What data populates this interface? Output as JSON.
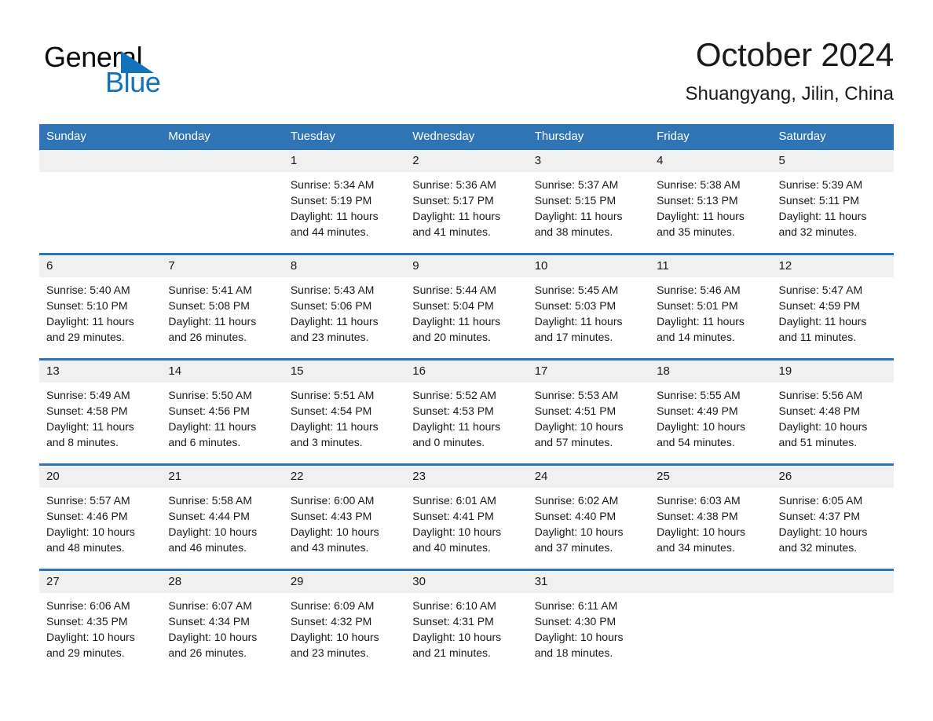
{
  "brand": {
    "logo_top": "General",
    "logo_bottom": "Blue",
    "accent_color": "#1272ba"
  },
  "header": {
    "title": "October 2024",
    "subtitle": "Shuangyang, Jilin, China",
    "header_bg_color": "#2f75b5",
    "daynum_bg_color": "#f0f0f0"
  },
  "weekday_headers": [
    "Sunday",
    "Monday",
    "Tuesday",
    "Wednesday",
    "Thursday",
    "Friday",
    "Saturday"
  ],
  "labels": {
    "sunrise_prefix": "Sunrise:",
    "sunset_prefix": "Sunset:",
    "daylight_prefix": "Daylight:"
  },
  "weeks": [
    [
      {
        "day": "",
        "sunrise": "",
        "sunset": "",
        "daylight": "",
        "empty": true
      },
      {
        "day": "",
        "sunrise": "",
        "sunset": "",
        "daylight": "",
        "empty": true
      },
      {
        "day": "1",
        "sunrise": "Sunrise: 5:34 AM",
        "sunset": "Sunset: 5:19 PM",
        "daylight": "Daylight: 11 hours and 44 minutes.",
        "empty": false
      },
      {
        "day": "2",
        "sunrise": "Sunrise: 5:36 AM",
        "sunset": "Sunset: 5:17 PM",
        "daylight": "Daylight: 11 hours and 41 minutes.",
        "empty": false
      },
      {
        "day": "3",
        "sunrise": "Sunrise: 5:37 AM",
        "sunset": "Sunset: 5:15 PM",
        "daylight": "Daylight: 11 hours and 38 minutes.",
        "empty": false
      },
      {
        "day": "4",
        "sunrise": "Sunrise: 5:38 AM",
        "sunset": "Sunset: 5:13 PM",
        "daylight": "Daylight: 11 hours and 35 minutes.",
        "empty": false
      },
      {
        "day": "5",
        "sunrise": "Sunrise: 5:39 AM",
        "sunset": "Sunset: 5:11 PM",
        "daylight": "Daylight: 11 hours and 32 minutes.",
        "empty": false
      }
    ],
    [
      {
        "day": "6",
        "sunrise": "Sunrise: 5:40 AM",
        "sunset": "Sunset: 5:10 PM",
        "daylight": "Daylight: 11 hours and 29 minutes.",
        "empty": false
      },
      {
        "day": "7",
        "sunrise": "Sunrise: 5:41 AM",
        "sunset": "Sunset: 5:08 PM",
        "daylight": "Daylight: 11 hours and 26 minutes.",
        "empty": false
      },
      {
        "day": "8",
        "sunrise": "Sunrise: 5:43 AM",
        "sunset": "Sunset: 5:06 PM",
        "daylight": "Daylight: 11 hours and 23 minutes.",
        "empty": false
      },
      {
        "day": "9",
        "sunrise": "Sunrise: 5:44 AM",
        "sunset": "Sunset: 5:04 PM",
        "daylight": "Daylight: 11 hours and 20 minutes.",
        "empty": false
      },
      {
        "day": "10",
        "sunrise": "Sunrise: 5:45 AM",
        "sunset": "Sunset: 5:03 PM",
        "daylight": "Daylight: 11 hours and 17 minutes.",
        "empty": false
      },
      {
        "day": "11",
        "sunrise": "Sunrise: 5:46 AM",
        "sunset": "Sunset: 5:01 PM",
        "daylight": "Daylight: 11 hours and 14 minutes.",
        "empty": false
      },
      {
        "day": "12",
        "sunrise": "Sunrise: 5:47 AM",
        "sunset": "Sunset: 4:59 PM",
        "daylight": "Daylight: 11 hours and 11 minutes.",
        "empty": false
      }
    ],
    [
      {
        "day": "13",
        "sunrise": "Sunrise: 5:49 AM",
        "sunset": "Sunset: 4:58 PM",
        "daylight": "Daylight: 11 hours and 8 minutes.",
        "empty": false
      },
      {
        "day": "14",
        "sunrise": "Sunrise: 5:50 AM",
        "sunset": "Sunset: 4:56 PM",
        "daylight": "Daylight: 11 hours and 6 minutes.",
        "empty": false
      },
      {
        "day": "15",
        "sunrise": "Sunrise: 5:51 AM",
        "sunset": "Sunset: 4:54 PM",
        "daylight": "Daylight: 11 hours and 3 minutes.",
        "empty": false
      },
      {
        "day": "16",
        "sunrise": "Sunrise: 5:52 AM",
        "sunset": "Sunset: 4:53 PM",
        "daylight": "Daylight: 11 hours and 0 minutes.",
        "empty": false
      },
      {
        "day": "17",
        "sunrise": "Sunrise: 5:53 AM",
        "sunset": "Sunset: 4:51 PM",
        "daylight": "Daylight: 10 hours and 57 minutes.",
        "empty": false
      },
      {
        "day": "18",
        "sunrise": "Sunrise: 5:55 AM",
        "sunset": "Sunset: 4:49 PM",
        "daylight": "Daylight: 10 hours and 54 minutes.",
        "empty": false
      },
      {
        "day": "19",
        "sunrise": "Sunrise: 5:56 AM",
        "sunset": "Sunset: 4:48 PM",
        "daylight": "Daylight: 10 hours and 51 minutes.",
        "empty": false
      }
    ],
    [
      {
        "day": "20",
        "sunrise": "Sunrise: 5:57 AM",
        "sunset": "Sunset: 4:46 PM",
        "daylight": "Daylight: 10 hours and 48 minutes.",
        "empty": false
      },
      {
        "day": "21",
        "sunrise": "Sunrise: 5:58 AM",
        "sunset": "Sunset: 4:44 PM",
        "daylight": "Daylight: 10 hours and 46 minutes.",
        "empty": false
      },
      {
        "day": "22",
        "sunrise": "Sunrise: 6:00 AM",
        "sunset": "Sunset: 4:43 PM",
        "daylight": "Daylight: 10 hours and 43 minutes.",
        "empty": false
      },
      {
        "day": "23",
        "sunrise": "Sunrise: 6:01 AM",
        "sunset": "Sunset: 4:41 PM",
        "daylight": "Daylight: 10 hours and 40 minutes.",
        "empty": false
      },
      {
        "day": "24",
        "sunrise": "Sunrise: 6:02 AM",
        "sunset": "Sunset: 4:40 PM",
        "daylight": "Daylight: 10 hours and 37 minutes.",
        "empty": false
      },
      {
        "day": "25",
        "sunrise": "Sunrise: 6:03 AM",
        "sunset": "Sunset: 4:38 PM",
        "daylight": "Daylight: 10 hours and 34 minutes.",
        "empty": false
      },
      {
        "day": "26",
        "sunrise": "Sunrise: 6:05 AM",
        "sunset": "Sunset: 4:37 PM",
        "daylight": "Daylight: 10 hours and 32 minutes.",
        "empty": false
      }
    ],
    [
      {
        "day": "27",
        "sunrise": "Sunrise: 6:06 AM",
        "sunset": "Sunset: 4:35 PM",
        "daylight": "Daylight: 10 hours and 29 minutes.",
        "empty": false
      },
      {
        "day": "28",
        "sunrise": "Sunrise: 6:07 AM",
        "sunset": "Sunset: 4:34 PM",
        "daylight": "Daylight: 10 hours and 26 minutes.",
        "empty": false
      },
      {
        "day": "29",
        "sunrise": "Sunrise: 6:09 AM",
        "sunset": "Sunset: 4:32 PM",
        "daylight": "Daylight: 10 hours and 23 minutes.",
        "empty": false
      },
      {
        "day": "30",
        "sunrise": "Sunrise: 6:10 AM",
        "sunset": "Sunset: 4:31 PM",
        "daylight": "Daylight: 10 hours and 21 minutes.",
        "empty": false
      },
      {
        "day": "31",
        "sunrise": "Sunrise: 6:11 AM",
        "sunset": "Sunset: 4:30 PM",
        "daylight": "Daylight: 10 hours and 18 minutes.",
        "empty": false
      },
      {
        "day": "",
        "sunrise": "",
        "sunset": "",
        "daylight": "",
        "empty": true
      },
      {
        "day": "",
        "sunrise": "",
        "sunset": "",
        "daylight": "",
        "empty": true
      }
    ]
  ]
}
